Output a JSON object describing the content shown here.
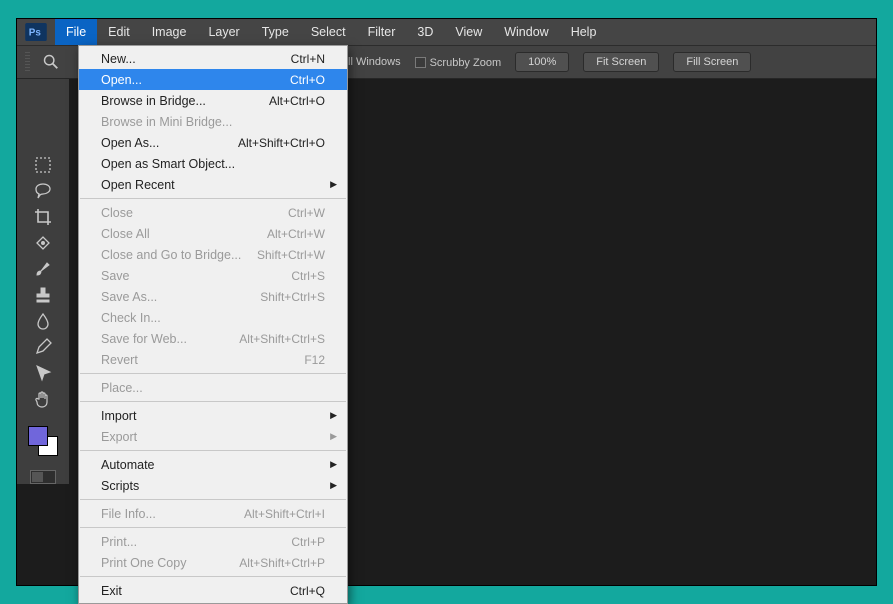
{
  "menubar": {
    "items": [
      "File",
      "Edit",
      "Image",
      "Layer",
      "Type",
      "Select",
      "Filter",
      "3D",
      "View",
      "Window",
      "Help"
    ],
    "open": "File"
  },
  "optbar": {
    "windows_label": "ll Windows",
    "scrubby_label": "Scrubby Zoom",
    "pct": "100%",
    "fit": "Fit Screen",
    "fill": "Fill Screen"
  },
  "filemenu": {
    "groups": [
      [
        {
          "label": "New...",
          "shortcut": "Ctrl+N"
        },
        {
          "label": "Open...",
          "shortcut": "Ctrl+O",
          "highlight": true
        },
        {
          "label": "Browse in Bridge...",
          "shortcut": "Alt+Ctrl+O"
        },
        {
          "label": "Browse in Mini Bridge...",
          "disabled": true
        },
        {
          "label": "Open As...",
          "shortcut": "Alt+Shift+Ctrl+O"
        },
        {
          "label": "Open as Smart Object..."
        },
        {
          "label": "Open Recent",
          "submenu": true
        }
      ],
      [
        {
          "label": "Close",
          "shortcut": "Ctrl+W",
          "disabled": true
        },
        {
          "label": "Close All",
          "shortcut": "Alt+Ctrl+W",
          "disabled": true
        },
        {
          "label": "Close and Go to Bridge...",
          "shortcut": "Shift+Ctrl+W",
          "disabled": true
        },
        {
          "label": "Save",
          "shortcut": "Ctrl+S",
          "disabled": true
        },
        {
          "label": "Save As...",
          "shortcut": "Shift+Ctrl+S",
          "disabled": true
        },
        {
          "label": "Check In...",
          "disabled": true
        },
        {
          "label": "Save for Web...",
          "shortcut": "Alt+Shift+Ctrl+S",
          "disabled": true
        },
        {
          "label": "Revert",
          "shortcut": "F12",
          "disabled": true
        }
      ],
      [
        {
          "label": "Place...",
          "disabled": true
        }
      ],
      [
        {
          "label": "Import",
          "submenu": true
        },
        {
          "label": "Export",
          "submenu": true,
          "disabled": true
        }
      ],
      [
        {
          "label": "Automate",
          "submenu": true
        },
        {
          "label": "Scripts",
          "submenu": true
        }
      ],
      [
        {
          "label": "File Info...",
          "shortcut": "Alt+Shift+Ctrl+I",
          "disabled": true
        }
      ],
      [
        {
          "label": "Print...",
          "shortcut": "Ctrl+P",
          "disabled": true
        },
        {
          "label": "Print One Copy",
          "shortcut": "Alt+Shift+Ctrl+P",
          "disabled": true
        }
      ],
      [
        {
          "label": "Exit",
          "shortcut": "Ctrl+Q"
        }
      ]
    ]
  },
  "tools": [
    "marquee",
    "lasso",
    "crop",
    "healing",
    "brush",
    "stamp",
    "blur",
    "pen",
    "arrow",
    "hand"
  ]
}
